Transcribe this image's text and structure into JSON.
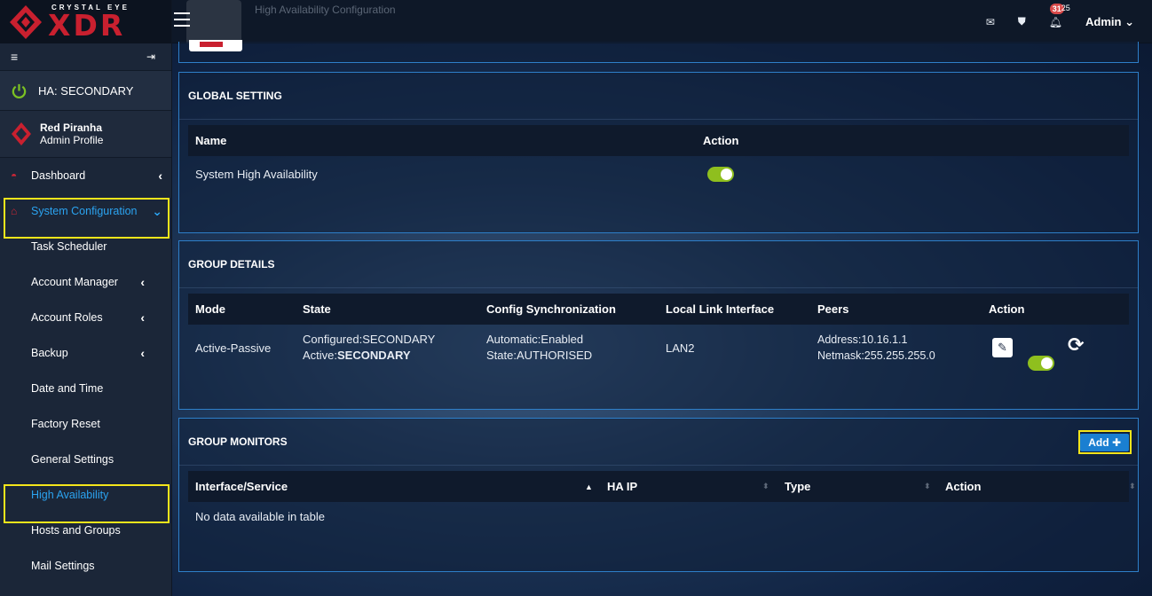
{
  "app": {
    "logo_small": "CRYSTAL EYE",
    "logo_big": "XDR",
    "page_title": "High Availability Configuration"
  },
  "sidebar": {
    "ha_status": "HA: SECONDARY",
    "profile_name": "Red Piranha",
    "profile_role": "Admin Profile",
    "items": [
      {
        "label": "Dashboard",
        "icon": "dashboard-icon",
        "chevron": "‹"
      },
      {
        "label": "System Configuration",
        "icon": "home-icon",
        "chevron": "⌄"
      },
      {
        "label": "Task Scheduler"
      },
      {
        "label": "Account Manager",
        "chevron": "‹"
      },
      {
        "label": "Account Roles",
        "chevron": "‹"
      },
      {
        "label": "Backup",
        "chevron": "‹"
      },
      {
        "label": "Date and Time"
      },
      {
        "label": "Factory Reset"
      },
      {
        "label": "General Settings"
      },
      {
        "label": "High Availability"
      },
      {
        "label": "Hosts and Groups"
      },
      {
        "label": "Mail Settings"
      }
    ]
  },
  "topbar": {
    "notification_count_a": "31",
    "notification_count_b": "25",
    "user": "Admin"
  },
  "global_setting": {
    "title": "GLOBAL SETTING",
    "col_name": "Name",
    "col_action": "Action",
    "row_name": "System High Availability",
    "enabled": true
  },
  "group_details": {
    "title": "GROUP DETAILS",
    "columns": [
      "Mode",
      "State",
      "Config Synchronization",
      "Local Link Interface",
      "Peers",
      "Action"
    ],
    "row": {
      "mode": "Active-Passive",
      "state_configured": "Configured:SECONDARY",
      "state_active_label": "Active:",
      "state_active_value": "SECONDARY",
      "sync_line1": "Automatic:Enabled",
      "sync_line2": "State:AUTHORISED",
      "interface": "LAN2",
      "peer_address": "Address:10.16.1.1",
      "peer_netmask": "Netmask:255.255.255.0"
    }
  },
  "group_monitors": {
    "title": "GROUP MONITORS",
    "add_label": "Add",
    "columns": [
      "Interface/Service",
      "HA IP",
      "Type",
      "Action"
    ],
    "empty_text": "No data available in table"
  },
  "colors": {
    "accent": "#2ba3f0",
    "brand": "#c9202f",
    "toggle_on": "#8fbf1e",
    "highlight": "#f4e51b"
  }
}
